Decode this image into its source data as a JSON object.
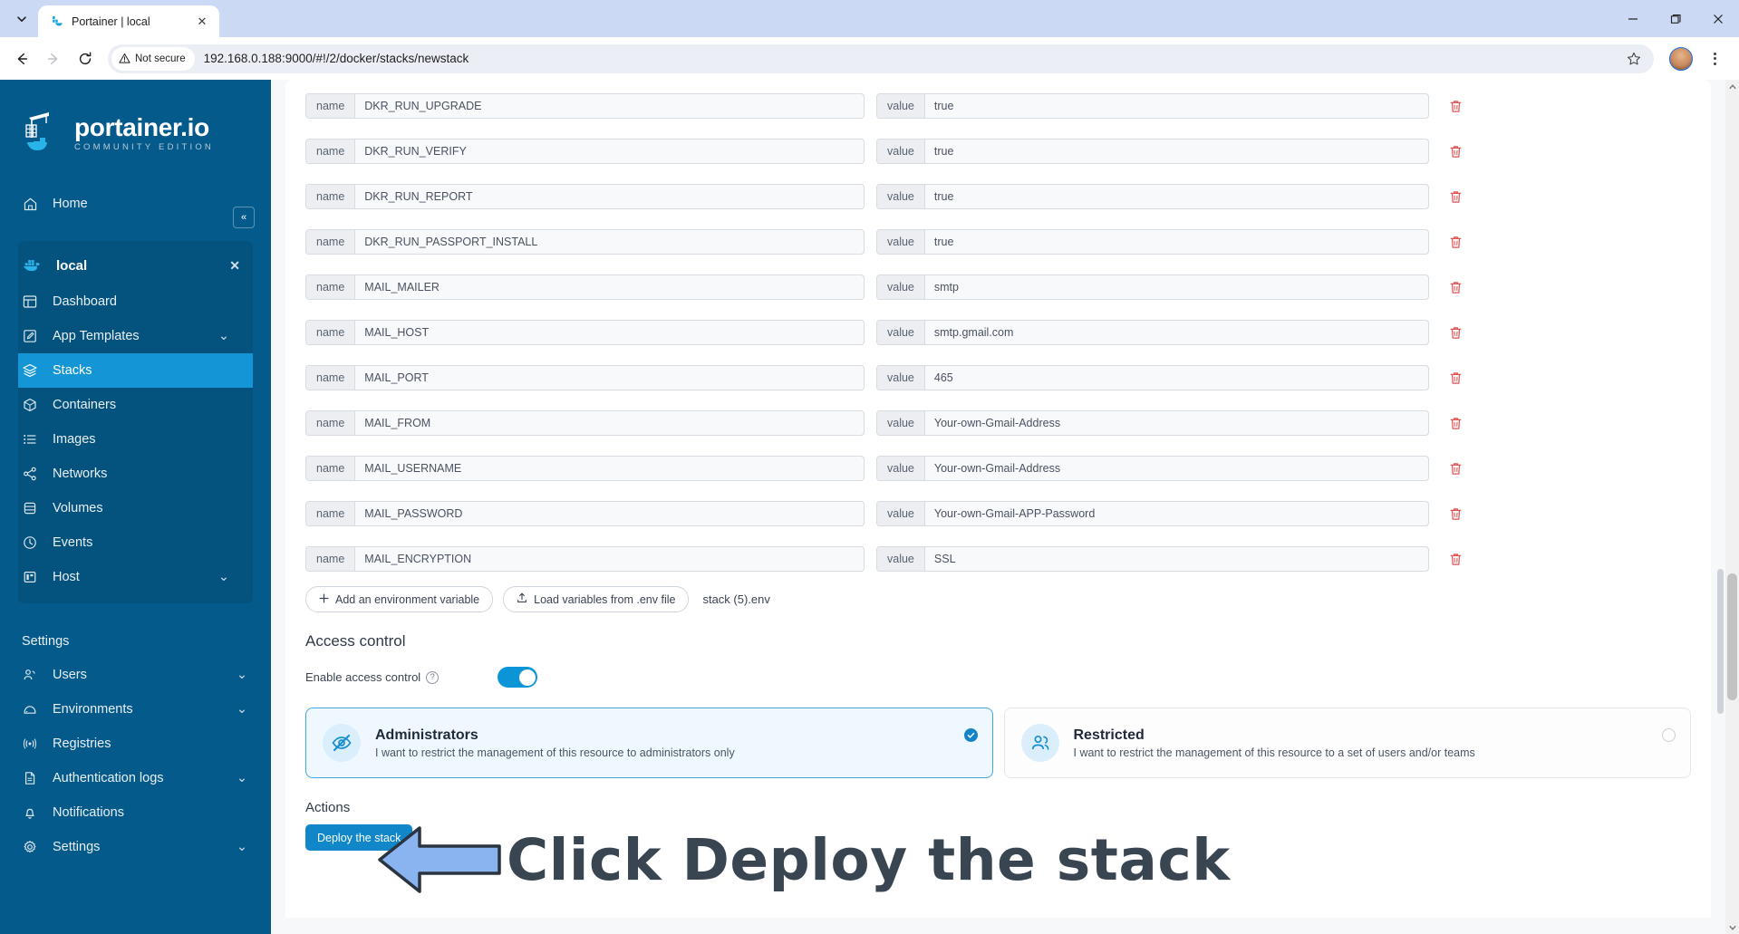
{
  "browser": {
    "tab": {
      "title": "Portainer | local",
      "favicon": "portainer-favicon-icon",
      "close": "✕"
    },
    "tab_list_chevron": "⌄",
    "window_controls": {
      "minimize": "—",
      "maximize": "❐",
      "close": "✕"
    },
    "nav": {
      "back": "←",
      "forward": "→",
      "reload": "⟳"
    },
    "security_label": "Not secure",
    "url": "192.168.0.188:9000/#!/2/docker/stacks/newstack",
    "star": "☆",
    "menu": "kebab-menu-icon"
  },
  "sidebar": {
    "logo_title": "portainer.io",
    "logo_sub": "COMMUNITY EDITION",
    "collapse": "«",
    "home": {
      "label": "Home",
      "icon": "home-icon"
    },
    "environment": {
      "label": "local",
      "icon": "docker-icon",
      "close": "✕"
    },
    "env_items": [
      {
        "label": "Dashboard",
        "icon": "dashboard-icon",
        "chevron": "",
        "active": false
      },
      {
        "label": "App Templates",
        "icon": "template-icon",
        "chevron": "⌄",
        "active": false
      },
      {
        "label": "Stacks",
        "icon": "stacks-icon",
        "chevron": "",
        "active": true
      },
      {
        "label": "Containers",
        "icon": "container-icon",
        "chevron": "",
        "active": false
      },
      {
        "label": "Images",
        "icon": "images-icon",
        "chevron": "",
        "active": false
      },
      {
        "label": "Networks",
        "icon": "network-icon",
        "chevron": "",
        "active": false
      },
      {
        "label": "Volumes",
        "icon": "volume-icon",
        "chevron": "",
        "active": false
      },
      {
        "label": "Events",
        "icon": "clock-icon",
        "chevron": "",
        "active": false
      },
      {
        "label": "Host",
        "icon": "host-icon",
        "chevron": "⌄",
        "active": false
      }
    ],
    "settings_label": "Settings",
    "settings_items": [
      {
        "label": "Users",
        "icon": "users-icon",
        "chevron": "⌄"
      },
      {
        "label": "Environments",
        "icon": "environments-icon",
        "chevron": "⌄"
      },
      {
        "label": "Registries",
        "icon": "registry-icon",
        "chevron": ""
      },
      {
        "label": "Authentication logs",
        "icon": "document-icon",
        "chevron": "⌄"
      },
      {
        "label": "Notifications",
        "icon": "bell-icon",
        "chevron": ""
      },
      {
        "label": "Settings",
        "icon": "gear-icon",
        "chevron": "⌄"
      }
    ]
  },
  "main": {
    "name_addon": "name",
    "value_addon": "value",
    "env_vars": [
      {
        "name": "DKR_RUN_UPGRADE",
        "value": "true"
      },
      {
        "name": "DKR_RUN_VERIFY",
        "value": "true"
      },
      {
        "name": "DKR_RUN_REPORT",
        "value": "true"
      },
      {
        "name": "DKR_RUN_PASSPORT_INSTALL",
        "value": "true"
      },
      {
        "name": "MAIL_MAILER",
        "value": "smtp"
      },
      {
        "name": "MAIL_HOST",
        "value": "smtp.gmail.com"
      },
      {
        "name": "MAIL_PORT",
        "value": "465"
      },
      {
        "name": "MAIL_FROM",
        "value": "Your-own-Gmail-Address"
      },
      {
        "name": "MAIL_USERNAME",
        "value": "Your-own-Gmail-Address"
      },
      {
        "name": "MAIL_PASSWORD",
        "value": "Your-own-Gmail-APP-Password"
      },
      {
        "name": "MAIL_ENCRYPTION",
        "value": "SSL"
      }
    ],
    "add_variable_label": "Add an environment variable",
    "add_variable_icon": "plus-icon",
    "load_env_label": "Load variables from .env file",
    "load_env_icon": "upload-icon",
    "env_filename": "stack (5).env",
    "access_control_title": "Access control",
    "enable_access_control_label": "Enable access control",
    "help_icon": "question-mark-icon",
    "toggle_state": "on",
    "acl_options": [
      {
        "title": "Administrators",
        "desc": "I want to restrict the management of this resource to administrators only",
        "icon": "eye-off-icon",
        "selected": true
      },
      {
        "title": "Restricted",
        "desc": "I want to restrict the management of this resource to a set of users and/or teams",
        "icon": "users-group-icon",
        "selected": false
      }
    ],
    "actions_title": "Actions",
    "deploy_label": "Deploy the stack"
  },
  "annotation": {
    "text": "Click Deploy the stack",
    "arrow": "left-arrow-annotation",
    "arrow_fill": "#8ab4f0",
    "arrow_stroke": "#2a3441",
    "text_color": "#3a4552"
  },
  "colors": {
    "sidebar": "#055a8c",
    "sidebar_active": "#1496d6",
    "accent": "#1186c9",
    "delete": "#e05252",
    "toggle_on": "#0b95d6"
  }
}
